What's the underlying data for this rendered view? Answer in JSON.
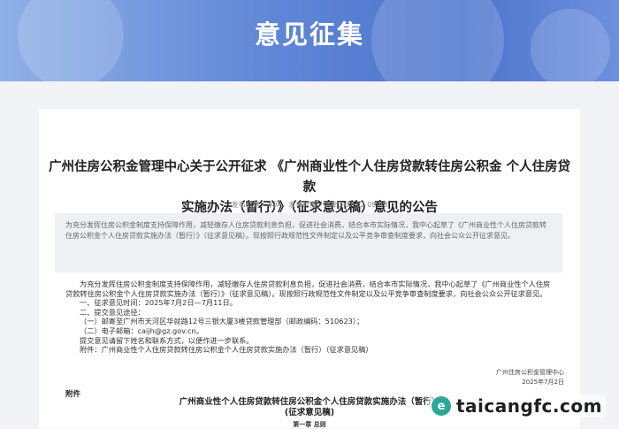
{
  "banner": {
    "title": "意见征集"
  },
  "article": {
    "title_line1": "广州住房公积金管理中心关于公开征求 《广州商业性个人住房贷款转住房公积金 个人住房贷款",
    "title_line2": "实施办法（暂行）》（征求意见稿）意见的公告",
    "meta": {
      "publisher": "发布机构：本网",
      "time": "发布时间：2025-07-02 09:40"
    },
    "summary": "为充分发挥住房公积金制度支持保障作用，减轻缴存人住房贷款利息负担，促进社会消费，结合本市实际情况，我中心起草了《广州商业性个人住房贷款转住房公积金个人住房贷款实施办法（暂行）》（征求意见稿）。现按照行政规范性文件制定以及公平竞争审查制度要求，向社会公众公开征求意见。",
    "body": [
      "为充分发挥住房公积金制度支持保障作用，减轻缴存人住房贷款利息负担，促进社会消费，结合本市实际情况，我中心起草了《广州商业性个人住房贷款转住房公积金个人住房贷款实施办法（暂行）》（征求意见稿）。现按照行政规范性文件制定以及公平竞争审查制度要求，向社会公众公开征求意见。",
      "一、征求意见时间：2025年7月2日—7月11日。",
      "二、提交意见途径：",
      "（一）邮寄至广州市天河区华就路12号三银大厦3楼贷款管理部（邮政编码：510623）；",
      "（二）电子邮箱：caijh@gz.gov.cn。",
      "提交意见请留下姓名和联系方式，以便作进一步联系。",
      "附件：广州商业性个人住房贷款转住房公积金个人住房贷款实施办法（暂行）（征求意见稿）"
    ],
    "signature": {
      "org": "广州住房公积金管理中心",
      "date": "2025年7月2日"
    },
    "attachment_label": "附件",
    "attachment_title_line1": "广州商业性个人住房贷款转住房公积金个人住房贷款实施办法（暂行）",
    "attachment_title_line2": "(征求意见稿)",
    "chapter": "第一章 总则"
  },
  "watermark": {
    "logo": "e",
    "text": "taicangfc.com"
  }
}
